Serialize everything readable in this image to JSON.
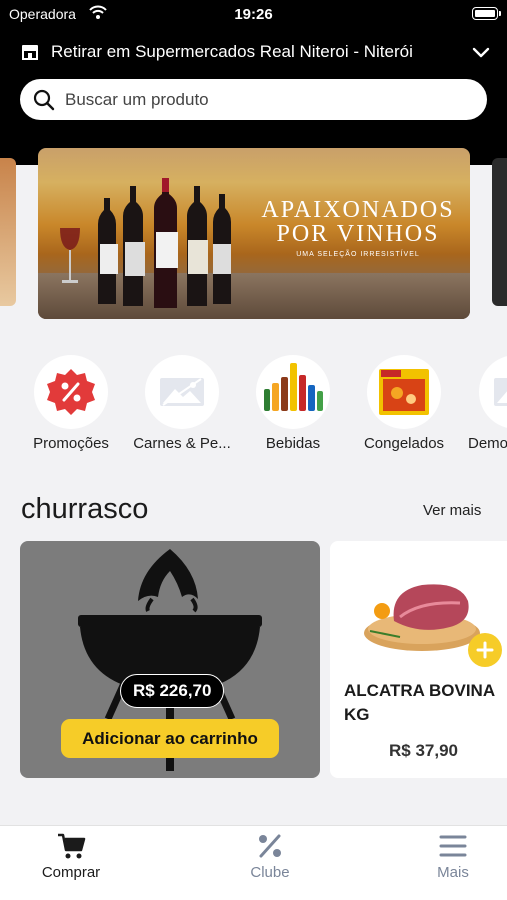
{
  "status_bar": {
    "carrier": "Operadora",
    "time": "19:26"
  },
  "header": {
    "store_label": "Retirar em Supermercados Real Niteroi - Niterói"
  },
  "search": {
    "placeholder": "Buscar um produto"
  },
  "banner": {
    "headline_line1": "APAIXONADOS",
    "headline_line2": "POR VINHOS",
    "subline": "UMA SELEÇÃO IRRESISTÍVEL"
  },
  "categories": [
    {
      "label": "Promoções",
      "icon": "percent-badge-icon"
    },
    {
      "label": "Carnes & Pe...",
      "icon": "image-placeholder-icon"
    },
    {
      "label": "Bebidas",
      "icon": "bottles-icon"
    },
    {
      "label": "Congelados",
      "icon": "frozen-box-icon"
    },
    {
      "label": "Demo",
      "icon": "image-placeholder-icon"
    }
  ],
  "section": {
    "title": "churrasco",
    "see_more": "Ver mais"
  },
  "featured_card": {
    "price": "R$ 226,70",
    "add_label": "Adicionar ao carrinho"
  },
  "product_card": {
    "name": "ALCATRA BOVINA KG",
    "price": "R$ 37,90"
  },
  "tabs": [
    {
      "label": "Comprar",
      "icon": "cart-icon",
      "active": true
    },
    {
      "label": "Clube",
      "icon": "percent-icon",
      "active": false
    },
    {
      "label": "Mais",
      "icon": "menu-icon",
      "active": false
    }
  ],
  "colors": {
    "accent": "#f6cc28",
    "promo_red": "#e23a3a",
    "inactive_tab": "#7a8599",
    "active_tab": "#1b1b1b"
  }
}
